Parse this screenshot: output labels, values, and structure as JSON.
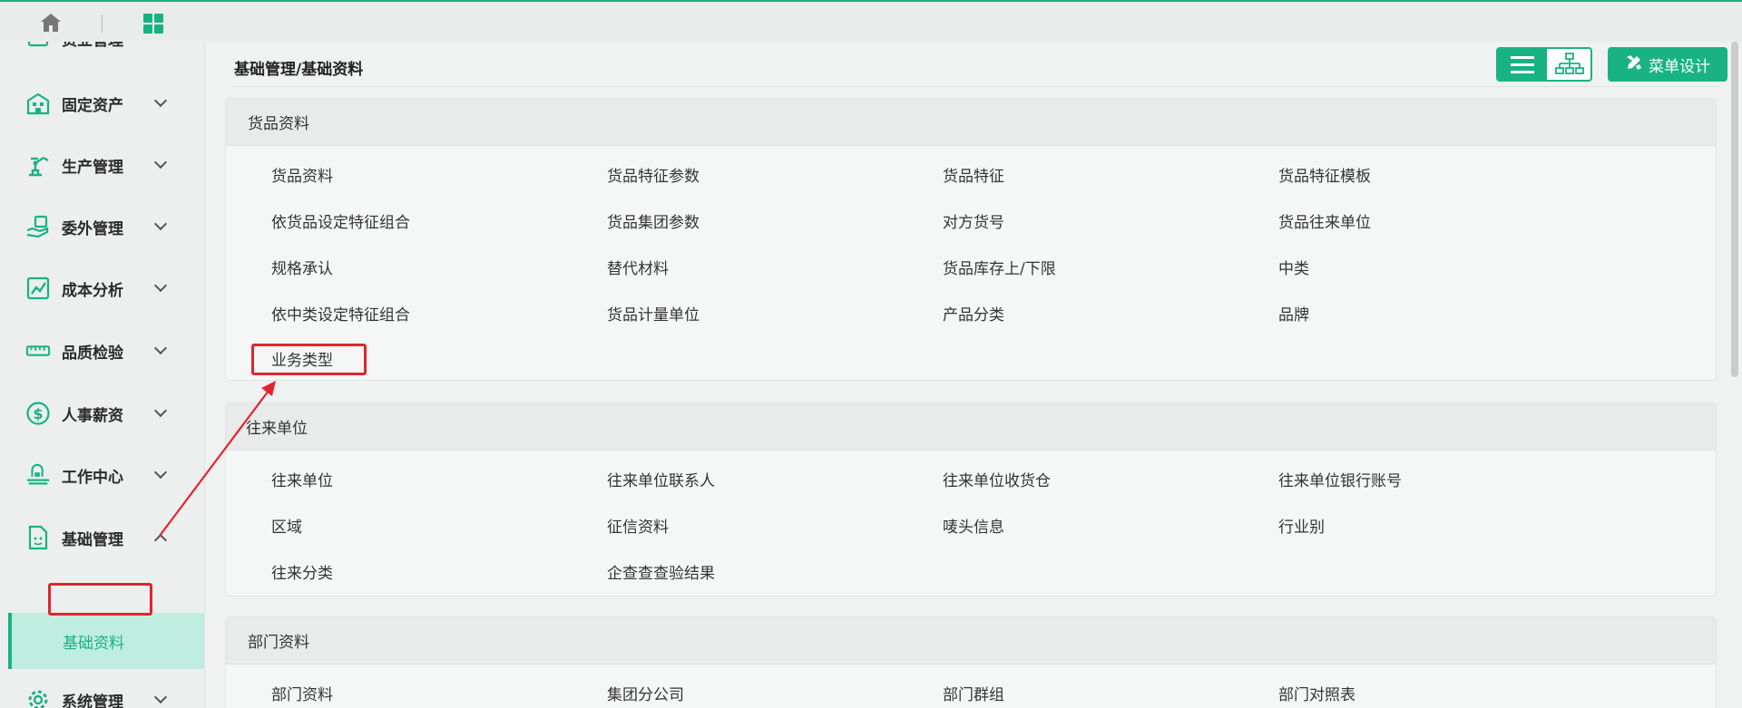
{
  "topbar": {
    "home_icon": "home-icon",
    "apps_icon": "grid-icon"
  },
  "sidebar": {
    "partial_top_label": "货业管理",
    "items": [
      {
        "label": "固定资产",
        "icon": "building-icon"
      },
      {
        "label": "生产管理",
        "icon": "robot-arm-icon"
      },
      {
        "label": "委外管理",
        "icon": "hand-box-icon"
      },
      {
        "label": "成本分析",
        "icon": "chart-icon"
      },
      {
        "label": "品质检验",
        "icon": "ruler-icon"
      },
      {
        "label": "人事薪资",
        "icon": "dollar-icon"
      },
      {
        "label": "工作中心",
        "icon": "workstation-icon"
      },
      {
        "label": "基础管理",
        "icon": "document-icon"
      },
      {
        "label": "系统管理",
        "icon": "gear-icon"
      }
    ],
    "active_sub": "基础资料"
  },
  "header": {
    "breadcrumb": "基础管理/基础资料",
    "menu_design_label": "菜单设计"
  },
  "sections": [
    {
      "title": "货品资料",
      "rows": [
        [
          "货品资料",
          "货品特征参数",
          "货品特征",
          "货品特征模板"
        ],
        [
          "依货品设定特征组合",
          "货品集团参数",
          "对方货号",
          "货品往来单位"
        ],
        [
          "规格承认",
          "替代材料",
          "货品库存上/下限",
          "中类"
        ],
        [
          "依中类设定特征组合",
          "货品计量单位",
          "产品分类",
          "品牌"
        ],
        [
          "业务类型"
        ]
      ]
    },
    {
      "title": "往来单位",
      "rows": [
        [
          "往来单位",
          "往来单位联系人",
          "往来单位收货仓",
          "往来单位银行账号"
        ],
        [
          "区域",
          "征信资料",
          "唛头信息",
          "行业别"
        ],
        [
          "往来分类",
          "企查查查验结果"
        ]
      ]
    },
    {
      "title": "部门资料",
      "rows": [
        [
          "部门资料",
          "集团分公司",
          "部门群组",
          "部门对照表"
        ]
      ]
    }
  ],
  "colors": {
    "accent": "#19b283",
    "highlight_box": "#e0242e"
  }
}
